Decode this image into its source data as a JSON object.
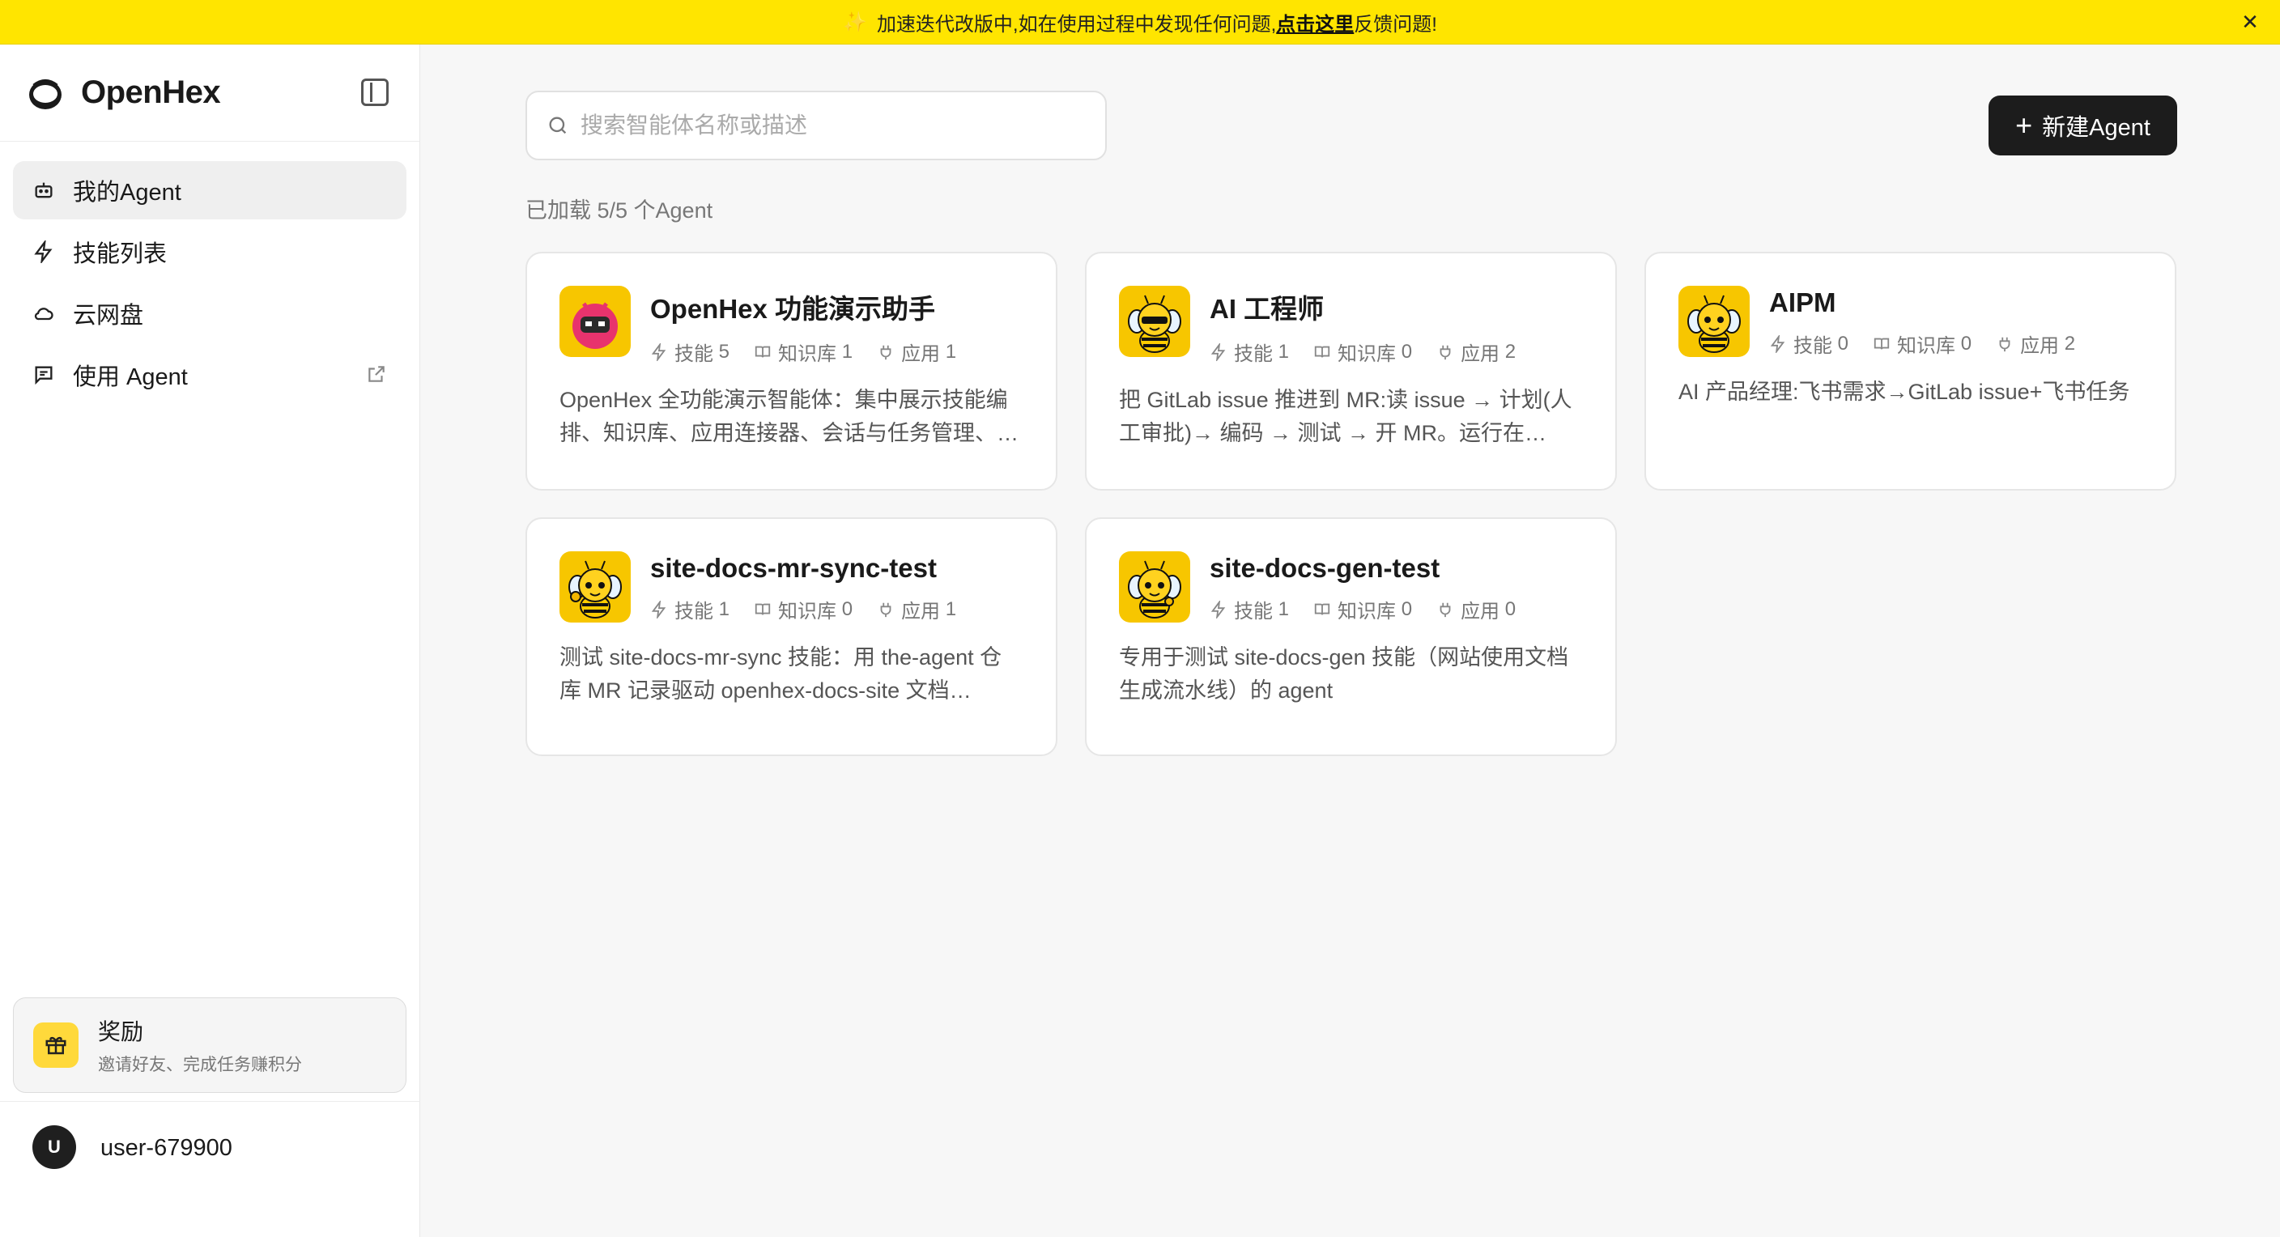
{
  "banner": {
    "text_before": "加速迭代改版中,如在使用过程中发现任何问题,",
    "link": "点击这里",
    "text_after": "反馈问题!"
  },
  "sidebar": {
    "brand": "OpenHex",
    "items": [
      {
        "label": "我的Agent",
        "icon": "bot-icon",
        "active": true
      },
      {
        "label": "技能列表",
        "icon": "lightning-icon"
      },
      {
        "label": "云网盘",
        "icon": "cloud-icon"
      },
      {
        "label": "使用 Agent",
        "icon": "chat-icon",
        "external": true
      }
    ],
    "reward": {
      "title": "奖励",
      "subtitle": "邀请好友、完成任务赚积分"
    },
    "user": {
      "initial": "U",
      "name": "user-679900"
    }
  },
  "main": {
    "search_placeholder": "搜索智能体名称或描述",
    "new_button": "新建Agent",
    "count_text": "已加载 5/5 个Agent",
    "stat_labels": {
      "skills": "技能",
      "kb": "知识库",
      "apps": "应用"
    },
    "agents": [
      {
        "name": "OpenHex 功能演示助手",
        "skills": "5",
        "kb": "1",
        "apps": "1",
        "desc": "OpenHex 全功能演示智能体：集中展示技能编排、知识库、应用连接器、会话与任务管理、…",
        "avatar": "robot"
      },
      {
        "name": "AI 工程师",
        "skills": "1",
        "kb": "0",
        "apps": "2",
        "desc": "把 GitLab issue 推进到 MR:读 issue → 计划(人工审批)→ 编码 → 测试 → 开 MR。运行在…",
        "avatar": "bee-cool"
      },
      {
        "name": "AIPM",
        "skills": "0",
        "kb": "0",
        "apps": "2",
        "desc": "AI 产品经理:飞书需求→GitLab issue+飞书任务",
        "avatar": "bee-happy"
      },
      {
        "name": "site-docs-mr-sync-test",
        "skills": "1",
        "kb": "0",
        "apps": "1",
        "desc": "测试 site-docs-mr-sync 技能：用 the-agent 仓库 MR 记录驱动 openhex-docs-site 文档…",
        "avatar": "bee-thumb"
      },
      {
        "name": "site-docs-gen-test",
        "skills": "1",
        "kb": "0",
        "apps": "0",
        "desc": "专用于测试 site-docs-gen 技能（网站使用文档生成流水线）的 agent",
        "avatar": "bee-think"
      }
    ]
  },
  "colors": {
    "banner": "#ffe500",
    "accent": "#1c1c1c",
    "avatar_bg": "#f7c600"
  }
}
